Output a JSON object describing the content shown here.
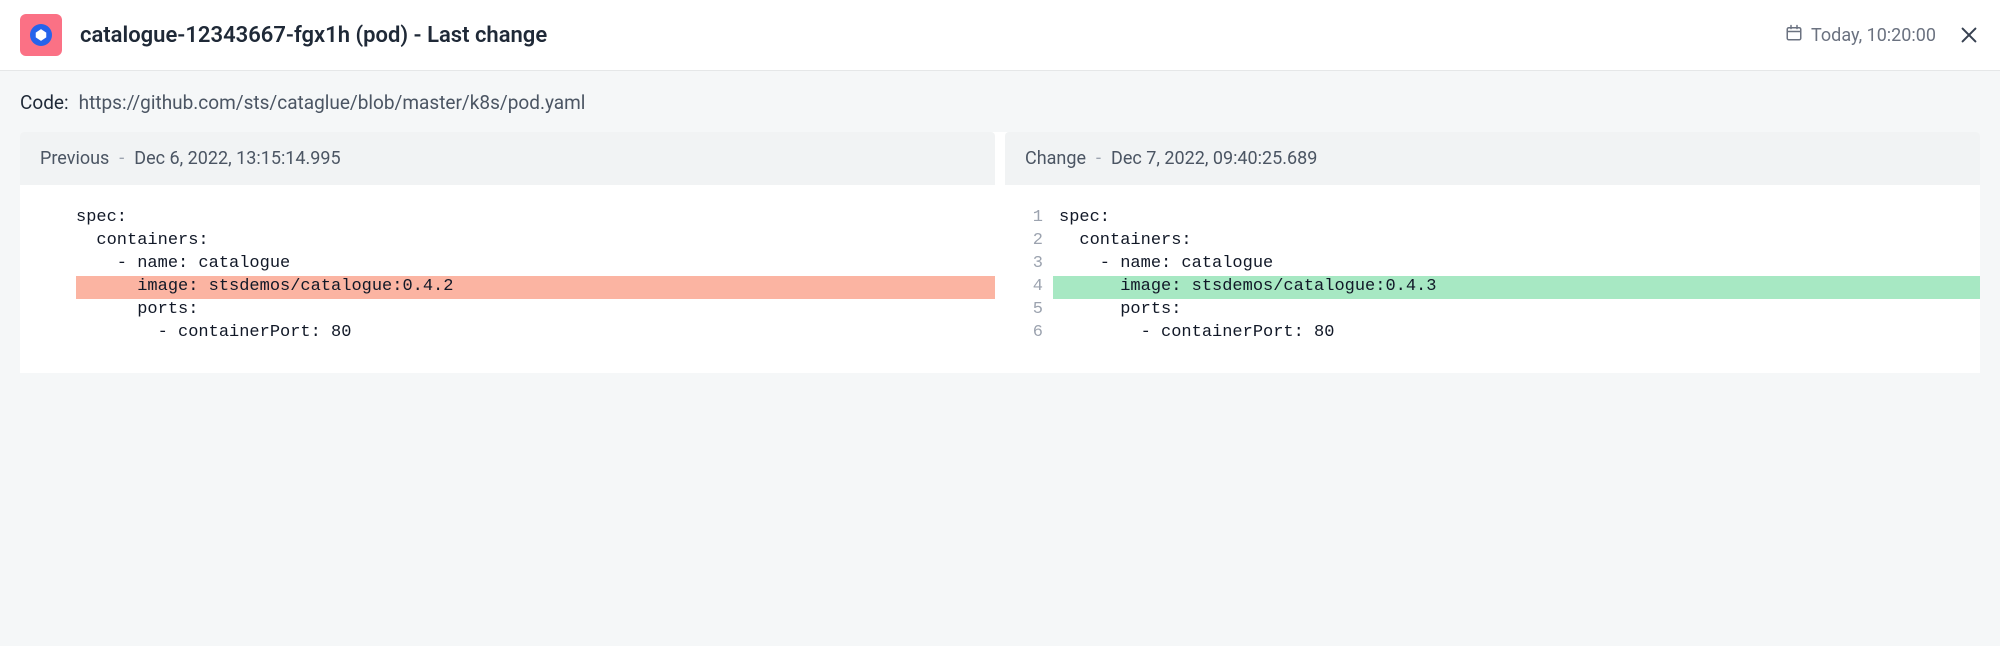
{
  "header": {
    "title": "catalogue-12343667-fgx1h (pod) - Last change",
    "timestamp": "Today, 10:20:00"
  },
  "code": {
    "label": "Code:",
    "url": "https://github.com/sts/cataglue/blob/master/k8s/pod.yaml"
  },
  "diff": {
    "previous": {
      "label": "Previous",
      "timestamp": "Dec 6, 2022, 13:15:14.995",
      "lines": [
        {
          "n": "",
          "text": "spec:",
          "type": "normal"
        },
        {
          "n": "",
          "text": "  containers:",
          "type": "normal"
        },
        {
          "n": "",
          "text": "    - name: catalogue",
          "type": "normal"
        },
        {
          "n": "",
          "text": "      image: stsdemos/catalogue:0.4.2",
          "type": "del"
        },
        {
          "n": "",
          "text": "      ports:",
          "type": "normal"
        },
        {
          "n": "",
          "text": "        - containerPort: 80",
          "type": "normal"
        }
      ]
    },
    "change": {
      "label": "Change",
      "timestamp": "Dec 7, 2022, 09:40:25.689",
      "lines": [
        {
          "n": "1",
          "text": "spec:",
          "type": "normal"
        },
        {
          "n": "2",
          "text": "  containers:",
          "type": "normal"
        },
        {
          "n": "3",
          "text": "    - name: catalogue",
          "type": "normal"
        },
        {
          "n": "4",
          "text": "      image: stsdemos/catalogue:0.4.3",
          "type": "add"
        },
        {
          "n": "5",
          "text": "      ports:",
          "type": "normal"
        },
        {
          "n": "6",
          "text": "        - containerPort: 80",
          "type": "normal"
        }
      ]
    }
  }
}
